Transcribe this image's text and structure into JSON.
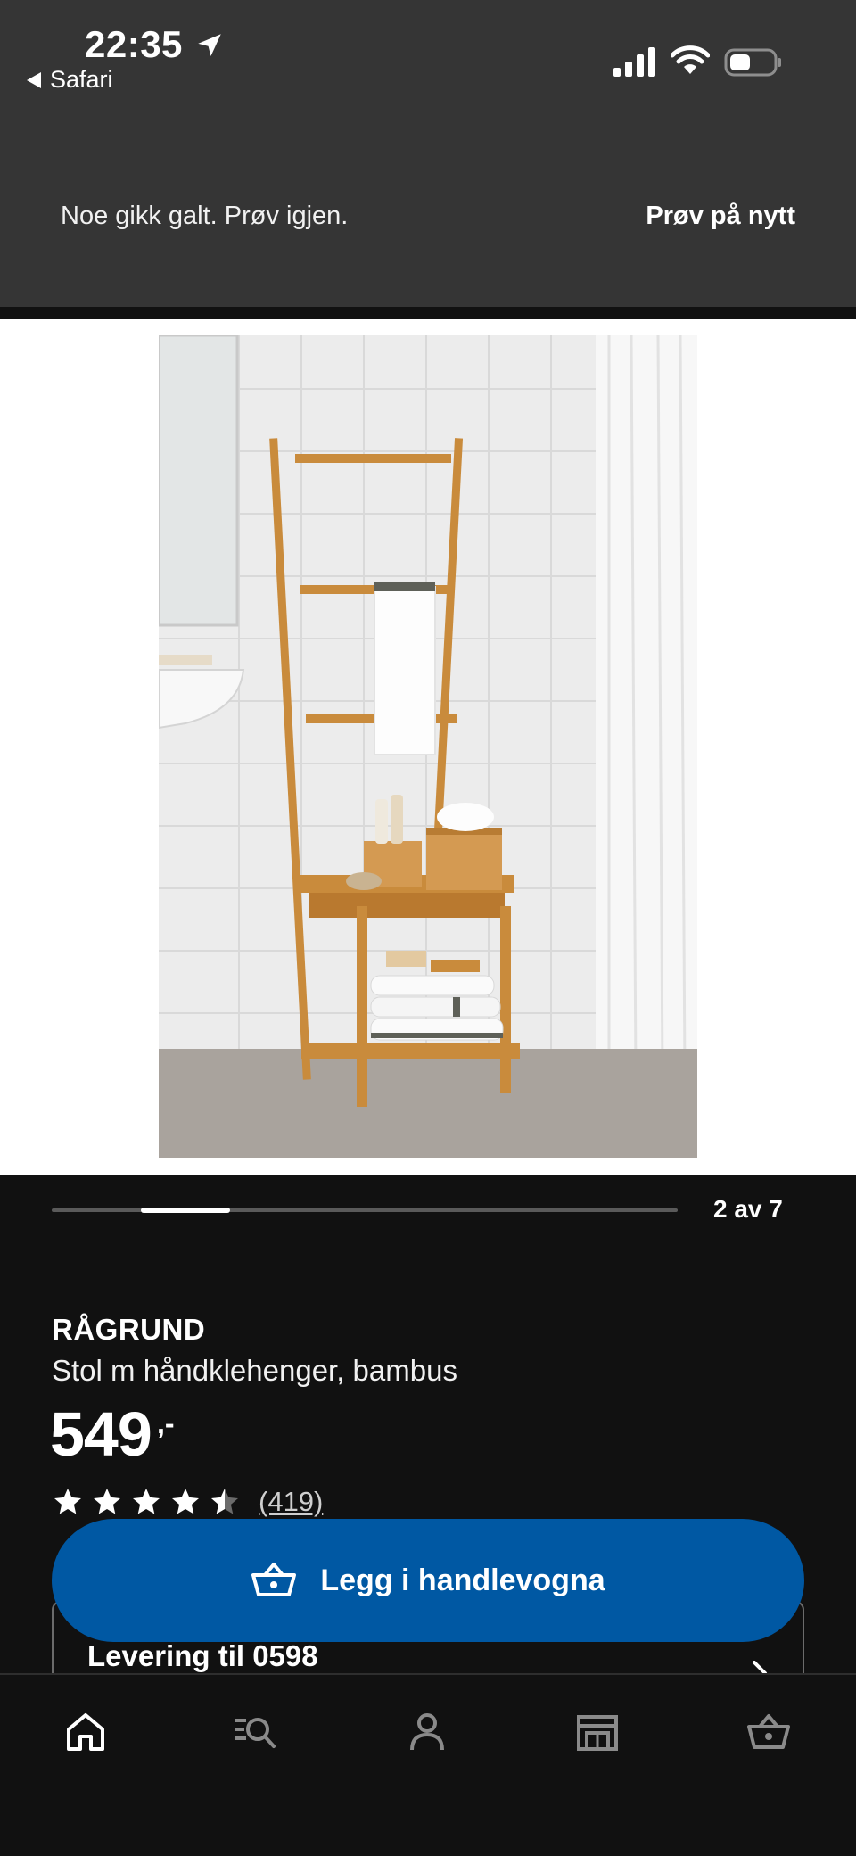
{
  "status_bar": {
    "time": "22:35",
    "back_app": "Safari"
  },
  "error_banner": {
    "message": "Noe gikk galt. Prøv igjen.",
    "retry_label": "Prøv på nytt"
  },
  "gallery": {
    "counter": "2 av 7",
    "current": 2,
    "total": 7
  },
  "product": {
    "name": "RÅGRUND",
    "description": "Stol m håndklehenger, bambus",
    "price": "549",
    "price_suffix": ",-",
    "rating": 4.5,
    "review_count": "(419)"
  },
  "actions": {
    "add_to_cart": "Legg i handlevogna"
  },
  "delivery": {
    "label": "Levering til 0598"
  },
  "bottom_nav": {
    "items": [
      "home-icon",
      "search-list-icon",
      "profile-icon",
      "store-icon",
      "cart-icon"
    ]
  },
  "colors": {
    "background": "#111111",
    "banner": "#353535",
    "primary_button": "#0058a3"
  }
}
